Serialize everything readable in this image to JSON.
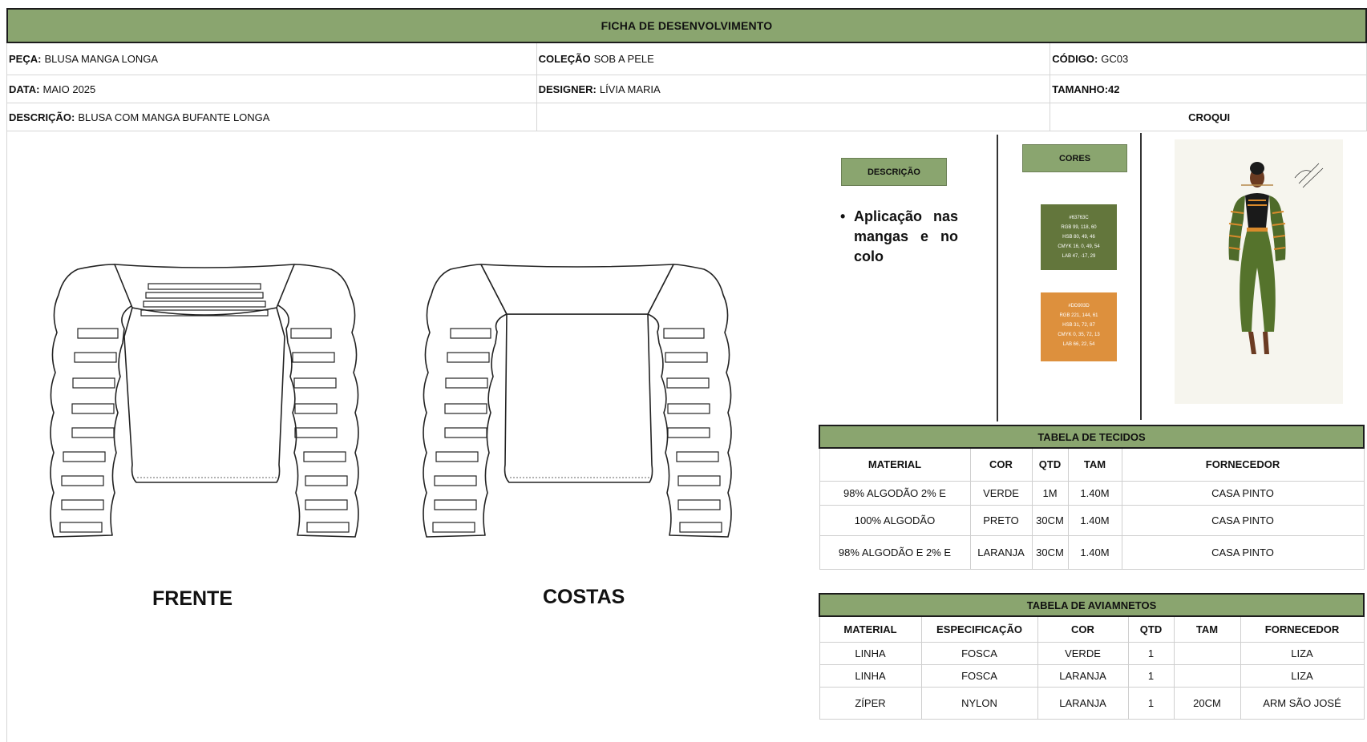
{
  "header": {
    "title": "FICHA DE DESENVOLVIMENTO"
  },
  "info": {
    "peca_label": "PEÇA:",
    "peca_value": "BLUSA MANGA LONGA",
    "colecao_label": "COLEÇÃO",
    "colecao_value": "SOB A PELE",
    "codigo_label": "CÓDIGO:",
    "codigo_value": "GC03",
    "data_label": "DATA:",
    "data_value": "MAIO 2025",
    "designer_label": "DESIGNER:",
    "designer_value": "LÍVIA MARIA",
    "tamanho_label": "TAMANHO:42",
    "descricao_label": "DESCRIÇÃO:",
    "descricao_value": "BLUSA COM MANGA BUFANTE LONGA",
    "croqui_label": "CROQUI"
  },
  "drawings": {
    "front_label": "FRENTE",
    "back_label": "COSTAS"
  },
  "descricao_box": {
    "title": "DESCRIÇÃO",
    "bullet": "Aplicação nas mangas e no colo"
  },
  "cores": {
    "title": "CORES",
    "swatches": [
      {
        "hex": "#63763C",
        "lines": [
          "#63763C",
          "RGB 99, 118, 60",
          "HSB 80, 49, 46",
          "CMYK 16, 0, 49, 54",
          "LAB 47, -17, 29"
        ]
      },
      {
        "hex": "#DD903D",
        "lines": [
          "#DD903D",
          "RGB 221, 144, 61",
          "HSB 31, 72, 87",
          "CMYK 0, 35, 72, 13",
          "LAB 66, 22, 54"
        ]
      }
    ]
  },
  "tecidos": {
    "caption": "TABELA DE TECIDOS",
    "headers": [
      "MATERIAL",
      "COR",
      "QTD",
      "TAM",
      "FORNECEDOR"
    ],
    "rows": [
      [
        "98% ALGODÃO 2% E",
        "VERDE",
        "1M",
        "1.40M",
        "CASA PINTO"
      ],
      [
        "100% ALGODÃO",
        "PRETO",
        "30CM",
        "1.40M",
        "CASA PINTO"
      ],
      [
        "98% ALGODÃO E 2% E",
        "LARANJA",
        "30CM",
        "1.40M",
        "CASA PINTO"
      ]
    ]
  },
  "aviamentos": {
    "caption": "TABELA DE AVIAMNETOS",
    "headers": [
      "MATERIAL",
      "ESPECIFICAÇÃO",
      "COR",
      "QTD",
      "TAM",
      "FORNECEDOR"
    ],
    "rows": [
      [
        "LINHA",
        "FOSCA",
        "VERDE",
        "1",
        "",
        "LIZA"
      ],
      [
        "LINHA",
        "FOSCA",
        "LARANJA",
        "1",
        "",
        "LIZA"
      ],
      [
        "ZÍPER",
        "NYLON",
        "LARANJA",
        "1",
        "20CM",
        "ARM SÃO JOSÉ"
      ]
    ]
  },
  "colors": {
    "header_green": "#8aa56f",
    "green_swatch": "#63763C",
    "orange_swatch": "#DD903D"
  }
}
